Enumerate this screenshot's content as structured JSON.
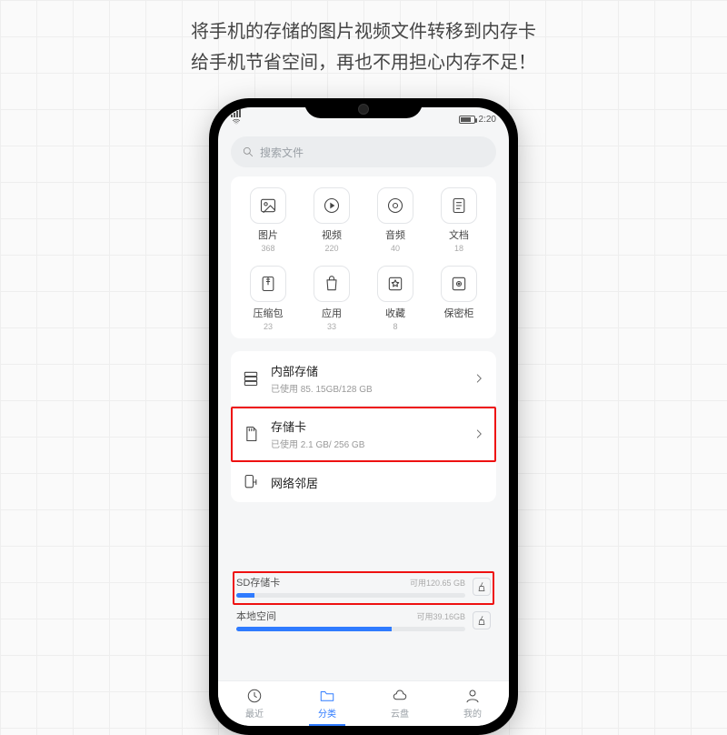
{
  "caption": {
    "line1": "将手机的存储的图片视频文件转移到内存卡",
    "line2": "给手机节省空间，再也不用担心内存不足！"
  },
  "status": {
    "time": "2:20"
  },
  "search": {
    "placeholder": "搜索文件"
  },
  "categories": [
    {
      "label": "图片",
      "count": "368"
    },
    {
      "label": "视频",
      "count": "220"
    },
    {
      "label": "音频",
      "count": "40"
    },
    {
      "label": "文档",
      "count": "18"
    },
    {
      "label": "压缩包",
      "count": "23"
    },
    {
      "label": "应用",
      "count": "33"
    },
    {
      "label": "收藏",
      "count": "8"
    },
    {
      "label": "保密柜",
      "count": ""
    }
  ],
  "storage": {
    "internal": {
      "title": "内部存储",
      "sub": "已使用 85. 15GB/128 GB"
    },
    "sdcard": {
      "title": "存储卡",
      "sub": "已使用 2.1 GB/ 256 GB"
    },
    "network": {
      "title": "网络邻居"
    }
  },
  "usage": {
    "sd": {
      "name": "SD存储卡",
      "avail_label": "可用",
      "avail": "120.65 GB",
      "fill_pct": 8
    },
    "local": {
      "name": "本地空间",
      "avail_label": "可用",
      "avail": "39.16GB",
      "fill_pct": 68
    }
  },
  "nav": {
    "recent": "最近",
    "category": "分类",
    "cloud": "云盘",
    "mine": "我的"
  }
}
